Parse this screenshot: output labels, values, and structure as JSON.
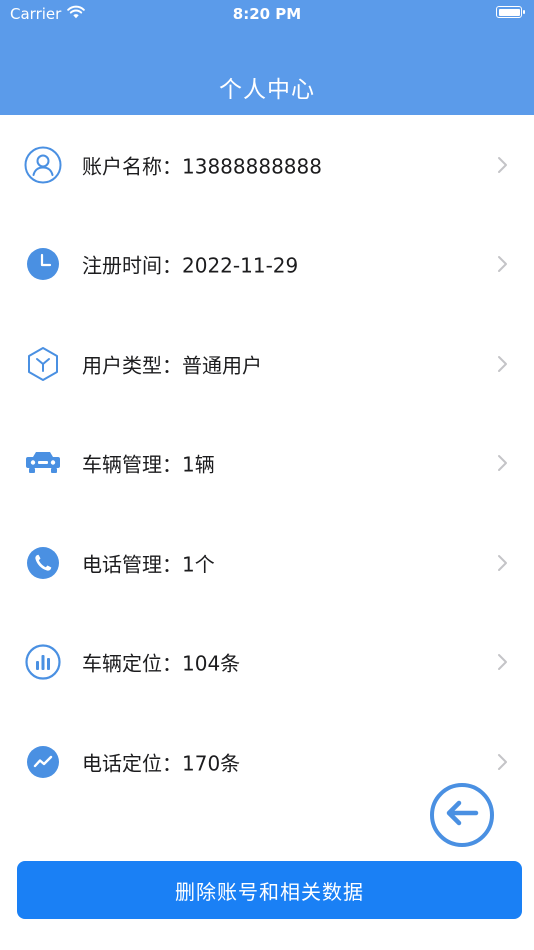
{
  "status_bar": {
    "carrier": "Carrier",
    "time": "8:20 PM"
  },
  "header": {
    "title": "个人中心"
  },
  "list": {
    "items": [
      {
        "label": "账户名称：",
        "value": "13888888888",
        "icon": "user-icon"
      },
      {
        "label": "注册时间：",
        "value": "2022-11-29",
        "icon": "clock-icon"
      },
      {
        "label": "用户类型：",
        "value": "普通用户",
        "icon": "cube-icon"
      },
      {
        "label": "车辆管理：",
        "value": "1辆",
        "icon": "car-icon"
      },
      {
        "label": "电话管理：",
        "value": "1个",
        "icon": "phone-icon"
      },
      {
        "label": "车辆定位：",
        "value": "104条",
        "icon": "bar-chart-icon"
      },
      {
        "label": "电话定位：",
        "value": "170条",
        "icon": "trend-icon"
      }
    ]
  },
  "actions": {
    "back_icon": "arrow-left-icon",
    "delete_label": "删除账号和相关数据"
  },
  "colors": {
    "header": "#5b9bea",
    "icon": "#4a90e2",
    "primary_button": "#1a80f5",
    "chevron": "#c4c4c7"
  }
}
